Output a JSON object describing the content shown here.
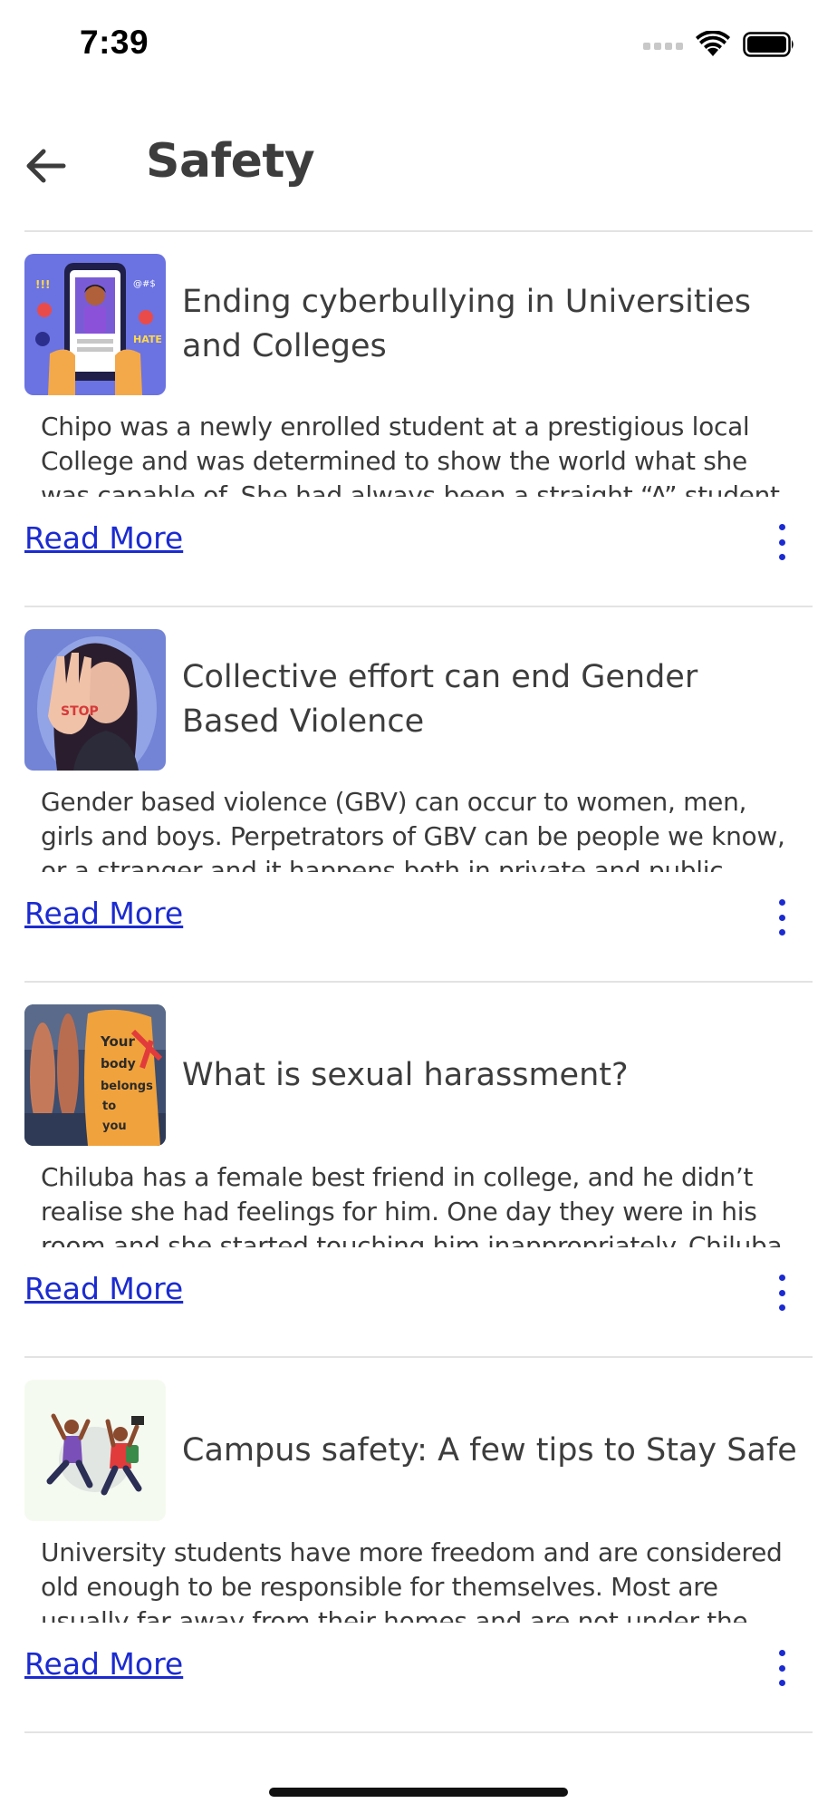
{
  "status_bar": {
    "time": "7:39"
  },
  "header": {
    "title": "Safety"
  },
  "colors": {
    "accent": "#1b2bd1",
    "text": "#3d3d3d",
    "divider": "#e3e3e3"
  },
  "articles": [
    {
      "title": "Ending cyberbullying in Universities and Colleges",
      "excerpt": "Chipo was a newly enrolled student at a prestigious local College and was determined to show the world what she was capable of. She had always been a straight “A” student",
      "read_more": "Read More",
      "image": "cyberbullying-illustration"
    },
    {
      "title": "Collective effort can end Gender Based Violence",
      "excerpt": "Gender based violence (GBV) can occur to women, men, girls and boys. Perpetrators of GBV can be people we know, or a stranger and it happens both in private and public",
      "read_more": "Read More",
      "image": "stop-gbv-illustration"
    },
    {
      "title": "What is sexual harassment?",
      "excerpt": "Chiluba has a female best friend in college, and he didn’t realise she had feelings for him. One day they were in his room and she started touching him inappropriately. Chiluba",
      "read_more": "Read More",
      "image": "protest-photo",
      "image_text": "Your body belongs to you"
    },
    {
      "title": "Campus safety: A few tips to Stay Safe",
      "excerpt": "University students have more freedom and are considered old enough to be responsible for themselves. Most are usually far away from their homes and are not under the supervision",
      "read_more": "Read More",
      "image": "students-jumping-illustration"
    }
  ]
}
